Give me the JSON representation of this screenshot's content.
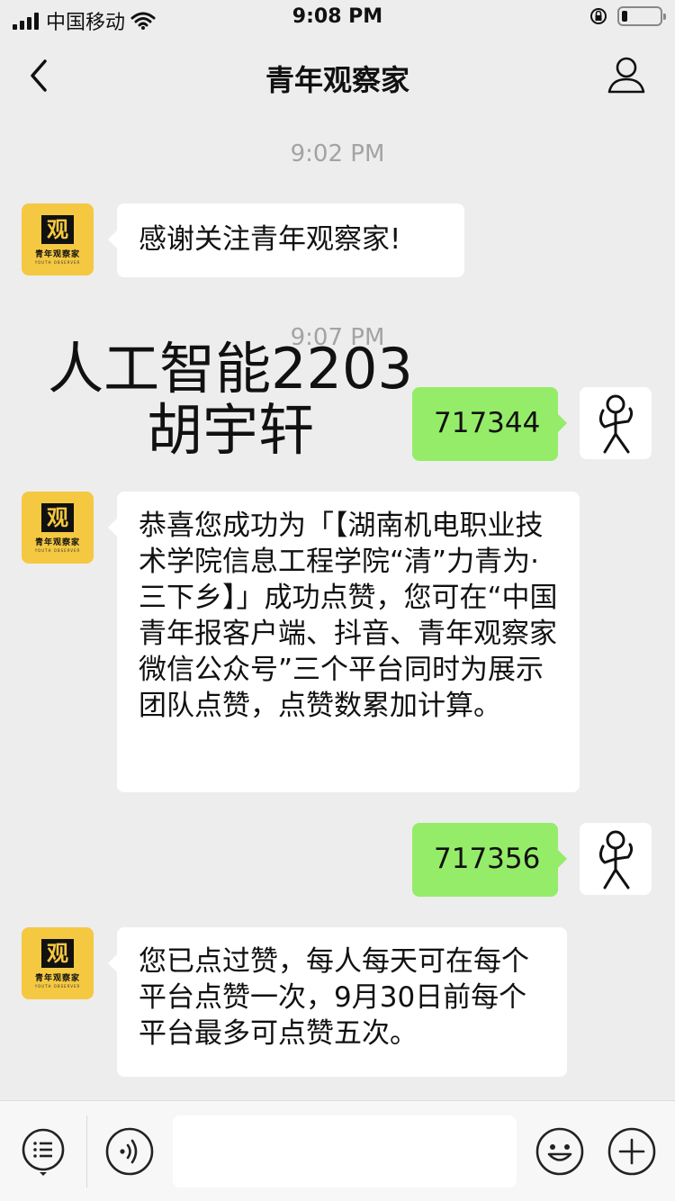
{
  "status_bar": {
    "carrier": "中国移动",
    "time": "9:08 PM"
  },
  "nav": {
    "title": "青年观察家",
    "back_icon": "chevron-left-icon",
    "profile_icon": "person-icon"
  },
  "official_avatar": {
    "logo_char": "观",
    "name": "青年观察家",
    "sub": "YOUTH OBSERVER"
  },
  "messages": [
    {
      "type": "timestamp",
      "text": "9:02 PM"
    },
    {
      "type": "incoming",
      "text": "感谢关注青年观察家!"
    },
    {
      "type": "timestamp",
      "text": "9:07 PM"
    },
    {
      "type": "outgoing",
      "text": "717344"
    },
    {
      "type": "incoming",
      "text": "恭喜您成功为「【湖南机电职业技术学院信息工程学院“清”力青为·三下乡】」成功点赞，您可在“中国青年报客户端、抖音、青年观察家微信公众号”三个平台同时为展示团队点赞，点赞数累加计算。"
    },
    {
      "type": "outgoing",
      "text": "717356"
    },
    {
      "type": "incoming",
      "text": "您已点过赞，每人每天可在每个平台点赞一次，9月30日前每个平台最多可点赞五次。"
    }
  ],
  "overlay": {
    "line1": "人工智能2203",
    "line2": "胡宇轩"
  },
  "bottom_bar": {
    "menu_icon": "menu-list-icon",
    "voice_icon": "voice-icon",
    "emoji_icon": "emoji-icon",
    "plus_icon": "plus-icon",
    "input_value": ""
  },
  "colors": {
    "background": "#ededed",
    "outgoing_bubble": "#95ec69",
    "incoming_bubble": "#ffffff",
    "official_avatar": "#f5c842"
  }
}
